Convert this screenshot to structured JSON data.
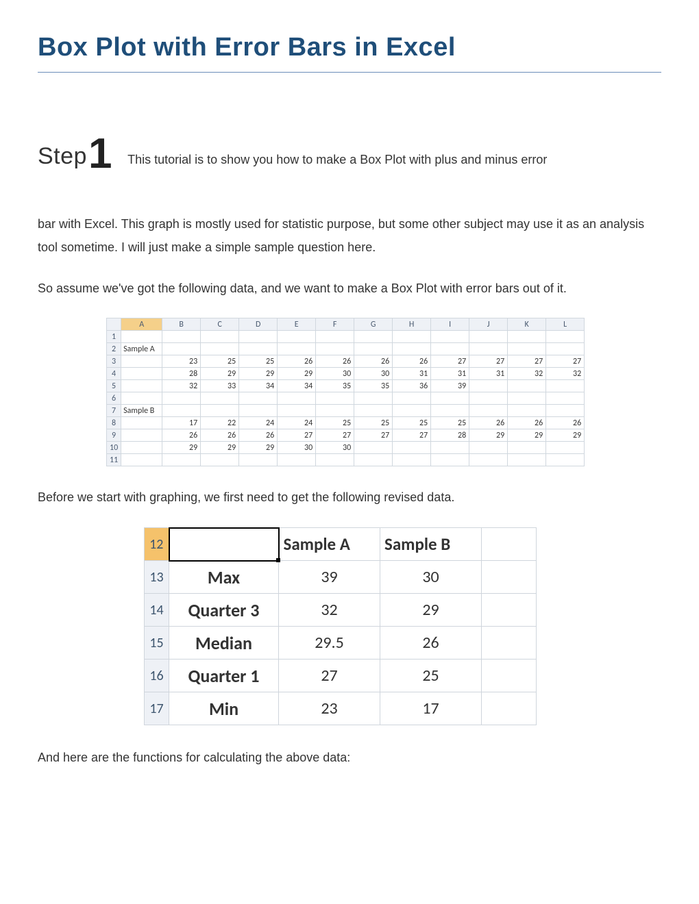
{
  "title": "Box Plot with Error Bars in Excel",
  "step": {
    "word": "Step",
    "num": "1"
  },
  "para": {
    "intro_first": "This tutorial is to show you how to make a Box Plot with plus and minus error",
    "intro_rest": "bar with Excel. This graph is mostly used for statistic purpose, but some other subject may use it as an analysis tool sometime. I will just make a simple sample question here.",
    "assume": "So assume we've got the following data, and we want to make a Box Plot with error bars out of it.",
    "before": "Before we start with graphing, we first need to get the following revised data.",
    "functions": "And here are the functions for calculating the above data:"
  },
  "excel1": {
    "cols": [
      "A",
      "B",
      "C",
      "D",
      "E",
      "F",
      "G",
      "H",
      "I",
      "J",
      "K",
      "L"
    ],
    "rows": [
      {
        "n": "1",
        "a": "",
        "v": [
          "",
          "",
          "",
          "",
          "",
          "",
          "",
          "",
          "",
          "",
          ""
        ]
      },
      {
        "n": "2",
        "a": "Sample A",
        "v": [
          "",
          "",
          "",
          "",
          "",
          "",
          "",
          "",
          "",
          "",
          ""
        ]
      },
      {
        "n": "3",
        "a": "",
        "v": [
          "23",
          "25",
          "25",
          "26",
          "26",
          "26",
          "26",
          "27",
          "27",
          "27",
          "27"
        ]
      },
      {
        "n": "4",
        "a": "",
        "v": [
          "28",
          "29",
          "29",
          "29",
          "30",
          "30",
          "31",
          "31",
          "31",
          "32",
          "32"
        ]
      },
      {
        "n": "5",
        "a": "",
        "v": [
          "32",
          "33",
          "34",
          "34",
          "35",
          "35",
          "36",
          "39",
          "",
          "",
          ""
        ]
      },
      {
        "n": "6",
        "a": "",
        "v": [
          "",
          "",
          "",
          "",
          "",
          "",
          "",
          "",
          "",
          "",
          ""
        ]
      },
      {
        "n": "7",
        "a": "Sample B",
        "v": [
          "",
          "",
          "",
          "",
          "",
          "",
          "",
          "",
          "",
          "",
          ""
        ]
      },
      {
        "n": "8",
        "a": "",
        "v": [
          "17",
          "22",
          "24",
          "24",
          "25",
          "25",
          "25",
          "25",
          "26",
          "26",
          "26"
        ]
      },
      {
        "n": "9",
        "a": "",
        "v": [
          "26",
          "26",
          "26",
          "27",
          "27",
          "27",
          "27",
          "28",
          "29",
          "29",
          "29"
        ]
      },
      {
        "n": "10",
        "a": "",
        "v": [
          "29",
          "29",
          "29",
          "30",
          "30",
          "",
          "",
          "",
          "",
          "",
          ""
        ]
      },
      {
        "n": "11",
        "a": "",
        "v": [
          "",
          "",
          "",
          "",
          "",
          "",
          "",
          "",
          "",
          "",
          ""
        ]
      }
    ]
  },
  "excel2": {
    "header": {
      "rownum": "12",
      "a": "",
      "b": "Sample A",
      "c": "Sample B"
    },
    "rows": [
      {
        "n": "13",
        "label": "Max",
        "a": "39",
        "b": "30"
      },
      {
        "n": "14",
        "label": "Quarter 3",
        "a": "32",
        "b": "29"
      },
      {
        "n": "15",
        "label": "Median",
        "a": "29.5",
        "b": "26"
      },
      {
        "n": "16",
        "label": "Quarter 1",
        "a": "27",
        "b": "25"
      },
      {
        "n": "17",
        "label": "Min",
        "a": "23",
        "b": "17"
      }
    ]
  },
  "chart_data": {
    "type": "table",
    "title": "Box Plot summary statistics",
    "series": [
      {
        "name": "Sample A",
        "values": {
          "Max": 39,
          "Quarter 3": 32,
          "Median": 29.5,
          "Quarter 1": 27,
          "Min": 23
        }
      },
      {
        "name": "Sample B",
        "values": {
          "Max": 30,
          "Quarter 3": 29,
          "Median": 26,
          "Quarter 1": 25,
          "Min": 17
        }
      }
    ],
    "raw": {
      "Sample A": [
        23,
        25,
        25,
        26,
        26,
        26,
        26,
        27,
        27,
        27,
        27,
        28,
        29,
        29,
        29,
        30,
        30,
        31,
        31,
        31,
        32,
        32,
        32,
        33,
        34,
        34,
        35,
        35,
        36,
        39
      ],
      "Sample B": [
        17,
        22,
        24,
        24,
        25,
        25,
        25,
        25,
        26,
        26,
        26,
        26,
        26,
        26,
        27,
        27,
        27,
        27,
        28,
        29,
        29,
        29,
        29,
        29,
        29,
        30,
        30
      ]
    }
  }
}
